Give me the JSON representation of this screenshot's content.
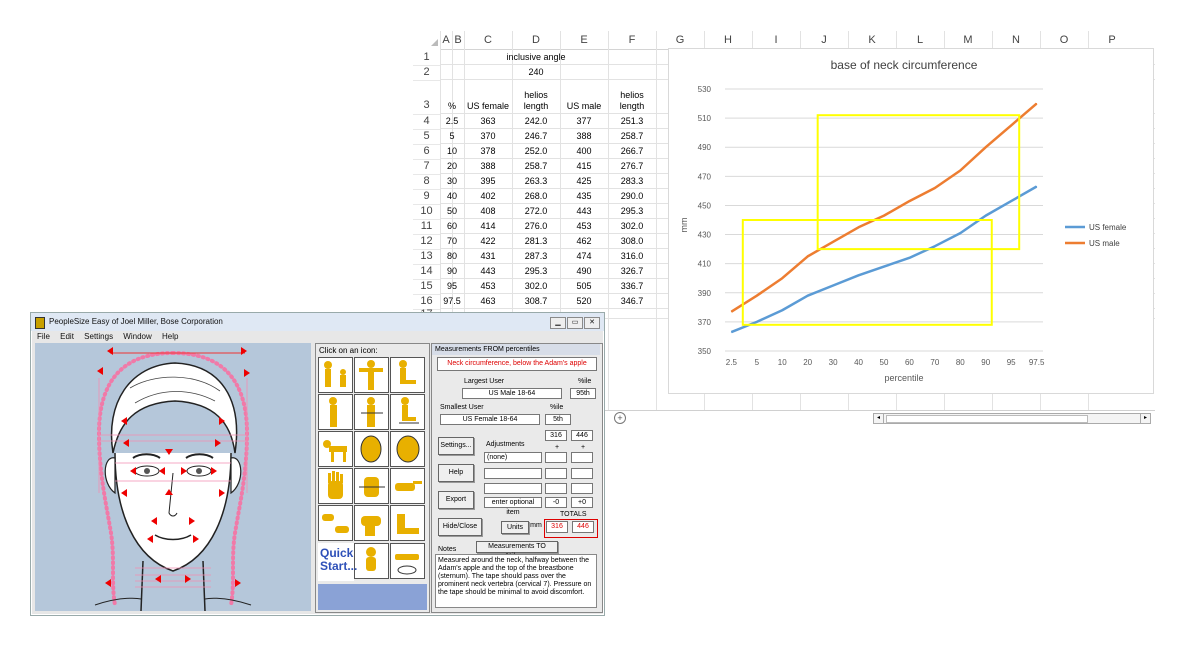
{
  "spreadsheet": {
    "columns": [
      "A",
      "B",
      "C",
      "D",
      "E",
      "F",
      "G",
      "H",
      "I",
      "J",
      "K",
      "L",
      "M",
      "N",
      "O",
      "P"
    ],
    "row_numbers": [
      "1",
      "2",
      "3",
      "4",
      "5",
      "6",
      "7",
      "8",
      "9",
      "10",
      "11",
      "12",
      "13",
      "14",
      "15",
      "16",
      "17"
    ],
    "header_row1": "inclusive angle",
    "header_row2": "240",
    "col_headers": {
      "pct": "%",
      "us_female": "US female",
      "helios_length_f": "helios length",
      "us_male": "US male",
      "helios_length_m": "helios length"
    },
    "rows": [
      [
        "2.5",
        "363",
        "242.0",
        "377",
        "251.3"
      ],
      [
        "5",
        "370",
        "246.7",
        "388",
        "258.7"
      ],
      [
        "10",
        "378",
        "252.0",
        "400",
        "266.7"
      ],
      [
        "20",
        "388",
        "258.7",
        "415",
        "276.7"
      ],
      [
        "30",
        "395",
        "263.3",
        "425",
        "283.3"
      ],
      [
        "40",
        "402",
        "268.0",
        "435",
        "290.0"
      ],
      [
        "50",
        "408",
        "272.0",
        "443",
        "295.3"
      ],
      [
        "60",
        "414",
        "276.0",
        "453",
        "302.0"
      ],
      [
        "70",
        "422",
        "281.3",
        "462",
        "308.0"
      ],
      [
        "80",
        "431",
        "287.3",
        "474",
        "316.0"
      ],
      [
        "90",
        "443",
        "295.3",
        "490",
        "326.7"
      ],
      [
        "95",
        "453",
        "302.0",
        "505",
        "336.7"
      ],
      [
        "97.5",
        "463",
        "308.7",
        "520",
        "346.7"
      ]
    ],
    "add_sheet_icon": "plus-circle-icon"
  },
  "chart_data": {
    "type": "line",
    "title": "base of neck circumference",
    "xlabel": "percentile",
    "ylabel": "mm",
    "categories": [
      "2.5",
      "5",
      "10",
      "20",
      "30",
      "40",
      "50",
      "60",
      "70",
      "80",
      "90",
      "95",
      "97.5"
    ],
    "ylim": [
      350,
      530
    ],
    "yticks": [
      350,
      370,
      390,
      410,
      430,
      450,
      470,
      490,
      510,
      530
    ],
    "grid": true,
    "legend_position": "right",
    "series": [
      {
        "name": "US female",
        "color": "#5b9bd5",
        "values": [
          363,
          370,
          378,
          388,
          395,
          402,
          408,
          414,
          422,
          431,
          443,
          453,
          463
        ]
      },
      {
        "name": "US male",
        "color": "#ed7d31",
        "values": [
          377,
          388,
          400,
          415,
          425,
          435,
          443,
          453,
          462,
          474,
          490,
          505,
          520
        ]
      }
    ],
    "highlight_color": "#ffff00"
  },
  "app": {
    "title": "PeopleSize Easy  of Joel Miller, Bose Corporation",
    "menu": [
      "File",
      "Edit",
      "Settings",
      "Window",
      "Help"
    ],
    "icon_panel_title": "Click on an icon:",
    "quick_start": "Quick Start...",
    "measurements": {
      "panel_title": "Measurements FROM percentiles",
      "measure_name": "Neck circumference, below the Adam's apple",
      "largest_user_label": "Largest User",
      "ile_label": "%ile",
      "largest_user": "US Male 18-64",
      "largest_pct": "95th",
      "smallest_user_label": "Smallest User",
      "smallest_user": "US Female 18-64",
      "smallest_pct": "5th",
      "val_small": "316",
      "val_large": "446",
      "adjustments_label": "Adjustments",
      "plus1": "+",
      "plus2": "+",
      "adjustment_none": "(none)",
      "optional_item": "enter optional item",
      "opt_small": "-0",
      "opt_large": "+0",
      "totals_label": "TOTALS",
      "units_button": "Units",
      "units_value": "mm",
      "total_small": "316",
      "total_large": "446",
      "settings_button": "Settings...",
      "help_button": "Help",
      "export_button": "Export",
      "hide_button": "Hide/Close",
      "to_pct_button": "Measurements TO %iles...",
      "notes_label": "Notes",
      "notes_text": "Measured around the neck, halfway between the Adam's apple and the top of the breastbone (sternum). The tape should pass over the prominent neck vertebra (cervical 7). Pressure on the tape should be minimal to avoid discomfort."
    }
  }
}
